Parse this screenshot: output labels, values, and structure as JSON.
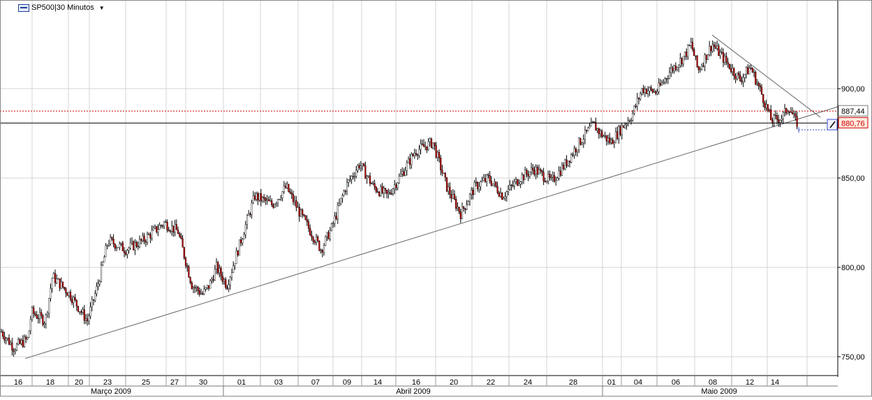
{
  "header": {
    "badge_icon": "cfd-badge-icon",
    "instrument": "SP500",
    "separator": "|",
    "timeframe": "30 Minutos",
    "dropdown_icon": "caret-down-icon"
  },
  "chart_data": {
    "type": "candlestick",
    "title": "SP500 | 30 Minutos",
    "xlabel": "",
    "ylabel": "",
    "ylim": [
      742,
      942
    ],
    "y_ticks": [
      750,
      800,
      850,
      900
    ],
    "y_tick_labels": [
      "750,00",
      "800,00",
      "850,00",
      "900,00"
    ],
    "grid": true,
    "x_day_ticks": [
      "16",
      "18",
      "20",
      "23",
      "25",
      "27",
      "30",
      "01",
      "03",
      "07",
      "09",
      "14",
      "16",
      "20",
      "22",
      "24",
      "28",
      "01",
      "04",
      "06",
      "08",
      "12",
      "14"
    ],
    "x_month_labels": [
      "Março 2009",
      "Abril 2009",
      "Maio 2009"
    ],
    "series": [
      {
        "name": "SP500",
        "approx_close_path": [
          [
            0,
            765
          ],
          [
            20,
            755
          ],
          [
            40,
            760
          ],
          [
            45,
            775
          ],
          [
            65,
            770
          ],
          [
            75,
            795
          ],
          [
            100,
            785
          ],
          [
            125,
            770
          ],
          [
            140,
            790
          ],
          [
            155,
            815
          ],
          [
            180,
            810
          ],
          [
            205,
            815
          ],
          [
            235,
            825
          ],
          [
            255,
            820
          ],
          [
            275,
            790
          ],
          [
            290,
            785
          ],
          [
            300,
            790
          ],
          [
            310,
            800
          ],
          [
            325,
            790
          ],
          [
            345,
            815
          ],
          [
            365,
            840
          ],
          [
            390,
            835
          ],
          [
            410,
            845
          ],
          [
            430,
            830
          ],
          [
            445,
            820
          ],
          [
            460,
            810
          ],
          [
            475,
            822
          ],
          [
            495,
            845
          ],
          [
            515,
            858
          ],
          [
            535,
            845
          ],
          [
            555,
            840
          ],
          [
            575,
            852
          ],
          [
            595,
            865
          ],
          [
            620,
            870
          ],
          [
            640,
            845
          ],
          [
            660,
            830
          ],
          [
            680,
            845
          ],
          [
            700,
            850
          ],
          [
            720,
            840
          ],
          [
            745,
            850
          ],
          [
            765,
            855
          ],
          [
            790,
            848
          ],
          [
            810,
            858
          ],
          [
            830,
            870
          ],
          [
            850,
            880
          ],
          [
            860,
            875
          ],
          [
            875,
            870
          ],
          [
            890,
            878
          ],
          [
            905,
            885
          ],
          [
            920,
            900
          ],
          [
            940,
            898
          ],
          [
            960,
            910
          ],
          [
            980,
            918
          ],
          [
            990,
            925
          ],
          [
            1000,
            910
          ],
          [
            1020,
            925
          ],
          [
            1040,
            915
          ],
          [
            1060,
            905
          ],
          [
            1075,
            912
          ],
          [
            1090,
            898
          ],
          [
            1105,
            882
          ],
          [
            1120,
            884
          ],
          [
            1130,
            890
          ],
          [
            1140,
            881
          ]
        ]
      }
    ],
    "price_levels": [
      {
        "label": "887,44",
        "value": 887.44,
        "style": "dotted",
        "color": "#cc0000"
      },
      {
        "label": "880,76",
        "value": 880.76,
        "style": "solid",
        "color": "#000000"
      }
    ],
    "trend_lines": [
      {
        "name": "ascending-support",
        "from": [
          36,
          749
        ],
        "to": [
          1201,
          890
        ]
      },
      {
        "name": "descending-resistance",
        "from": [
          1020,
          930
        ],
        "to": [
          1175,
          884
        ]
      }
    ],
    "colors": {
      "up": "#ffffff",
      "down": "#c00000",
      "wick": "#000000",
      "grid": "#d4d4d4"
    }
  },
  "tools": {
    "draw_tool_icon": "pencil-tool-icon"
  }
}
